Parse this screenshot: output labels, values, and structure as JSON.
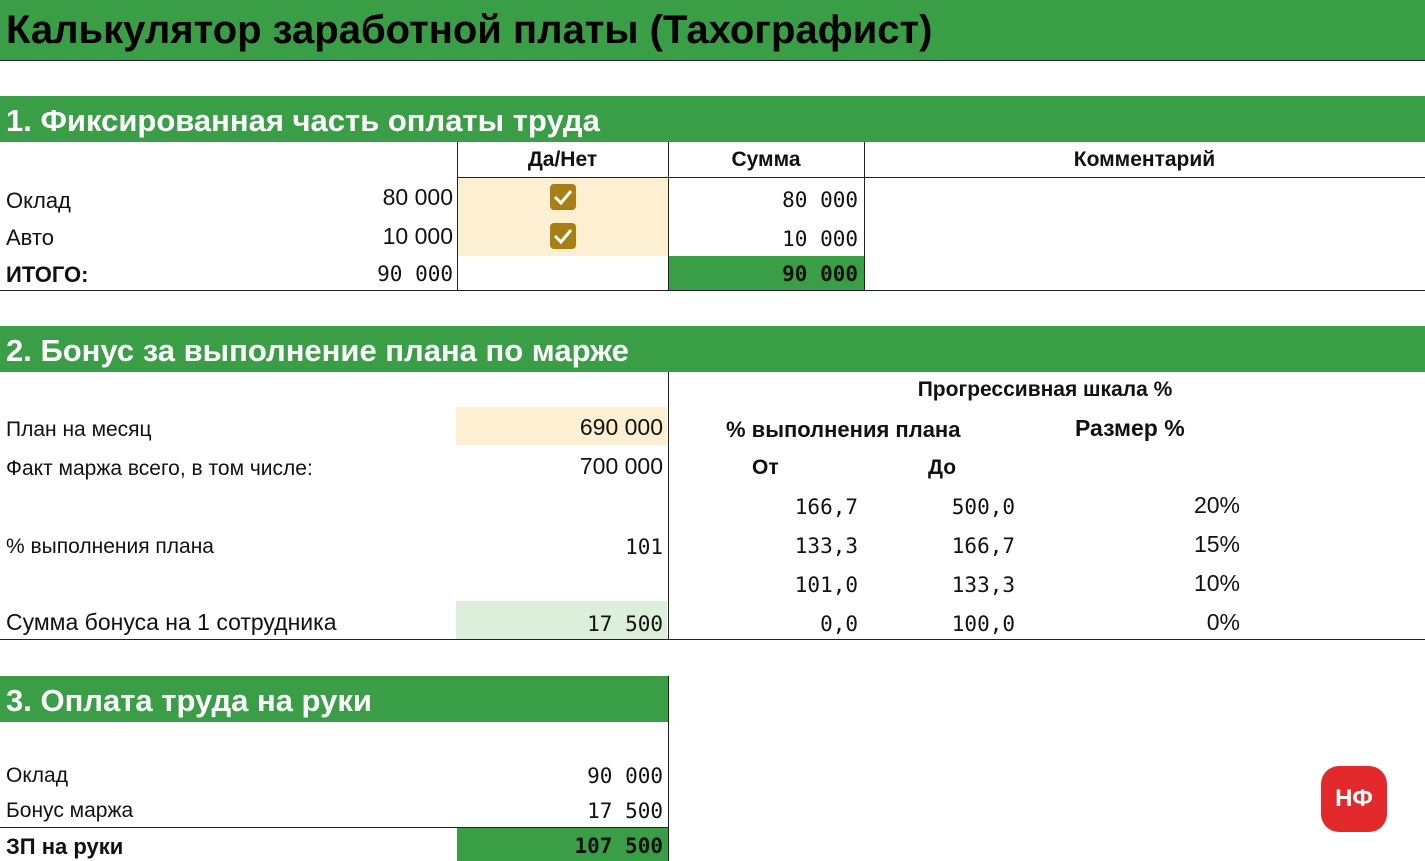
{
  "title": "Калькулятор заработной платы (Тахографист)",
  "section1": {
    "heading": "1. Фиксированная часть оплаты труда",
    "col_yesno": "Да/Нет",
    "col_sum": "Сумма",
    "col_comment": "Комментарий",
    "rows": [
      {
        "label": "Оклад",
        "value": "80 000",
        "checked": true,
        "sum": "80 000"
      },
      {
        "label": "Авто",
        "value": "10 000",
        "checked": true,
        "sum": "10 000"
      }
    ],
    "total_label": "ИТОГО:",
    "total_value": "90 000",
    "total_sum": "90 000"
  },
  "section2": {
    "heading": "2. Бонус за выполнение плана по марже",
    "plan_label": "План на месяц",
    "plan_value": "690 000",
    "fact_label": "Факт маржа всего, в том числе:",
    "fact_value": "700 000",
    "pct_label": "% выполнения плана",
    "pct_value": "101",
    "bonus_label": "Сумма бонуса на 1 сотрудника",
    "bonus_value": "17 500",
    "scale_title": "Прогрессивная шкала %",
    "scale_col1": "% выполнения плана",
    "scale_col2": "Размер %",
    "scale_from": "От",
    "scale_to": "До",
    "scale_rows": [
      {
        "from": "166,7",
        "to": "500,0",
        "size": "20%"
      },
      {
        "from": "133,3",
        "to": "166,7",
        "size": "15%"
      },
      {
        "from": "101,0",
        "to": "133,3",
        "size": "10%"
      },
      {
        "from": "0,0",
        "to": "100,0",
        "size": "0%"
      }
    ]
  },
  "section3": {
    "heading": "3. Оплата труда на руки",
    "salary_label": "Оклад",
    "salary_value": "90 000",
    "bonus_label": "Бонус маржа",
    "bonus_value": "17 500",
    "total_label": "ЗП на руки",
    "total_value": "107 500"
  },
  "logo_text": "НФ",
  "colors": {
    "band": "#3a9e46",
    "input": "#fdf0d2",
    "result_light": "#dcefdb",
    "check": "#a77f14",
    "logo": "#e3292b"
  }
}
